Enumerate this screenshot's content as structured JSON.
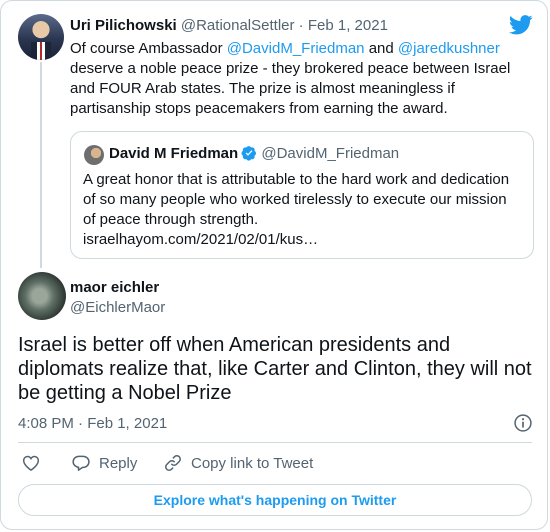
{
  "parent_tweet": {
    "author_name": "Uri Pilichowski",
    "handle": "@RationalSettler",
    "separator": "·",
    "date": "Feb 1, 2021",
    "text_parts": [
      "Of course Ambassador ",
      "@DavidM_Friedman",
      " and ",
      "@jaredkushner",
      " deserve a noble peace prize - they brokered peace between Israel and FOUR Arab states. The prize is almost meaningless if partisanship stops peacemakers from earning the award."
    ]
  },
  "quote_tweet": {
    "author_name": "David M Friedman",
    "handle": "@DavidM_Friedman",
    "verified_icon": "verified-badge-icon",
    "text": "A great honor that is attributable to the hard work and dedication of so many people who worked tirelessly to execute our mission of peace through strength.",
    "link": "israelhayom.com/2021/02/01/kus…"
  },
  "main_tweet": {
    "author_name": "maor eichler",
    "handle": "@EichlerMaor",
    "text": "Israel is better off when American presidents and diplomats realize that, like Carter and Clinton, they will not be getting a Nobel Prize",
    "time": "4:08 PM · Feb 1, 2021"
  },
  "actions": {
    "like_icon": "heart-icon",
    "reply_label": "Reply",
    "copy_label": "Copy link to Tweet"
  },
  "explore_button": "Explore what's happening on Twitter",
  "colors": {
    "accent": "#1d9bf0",
    "muted": "#536471",
    "border": "#cfd9de"
  }
}
